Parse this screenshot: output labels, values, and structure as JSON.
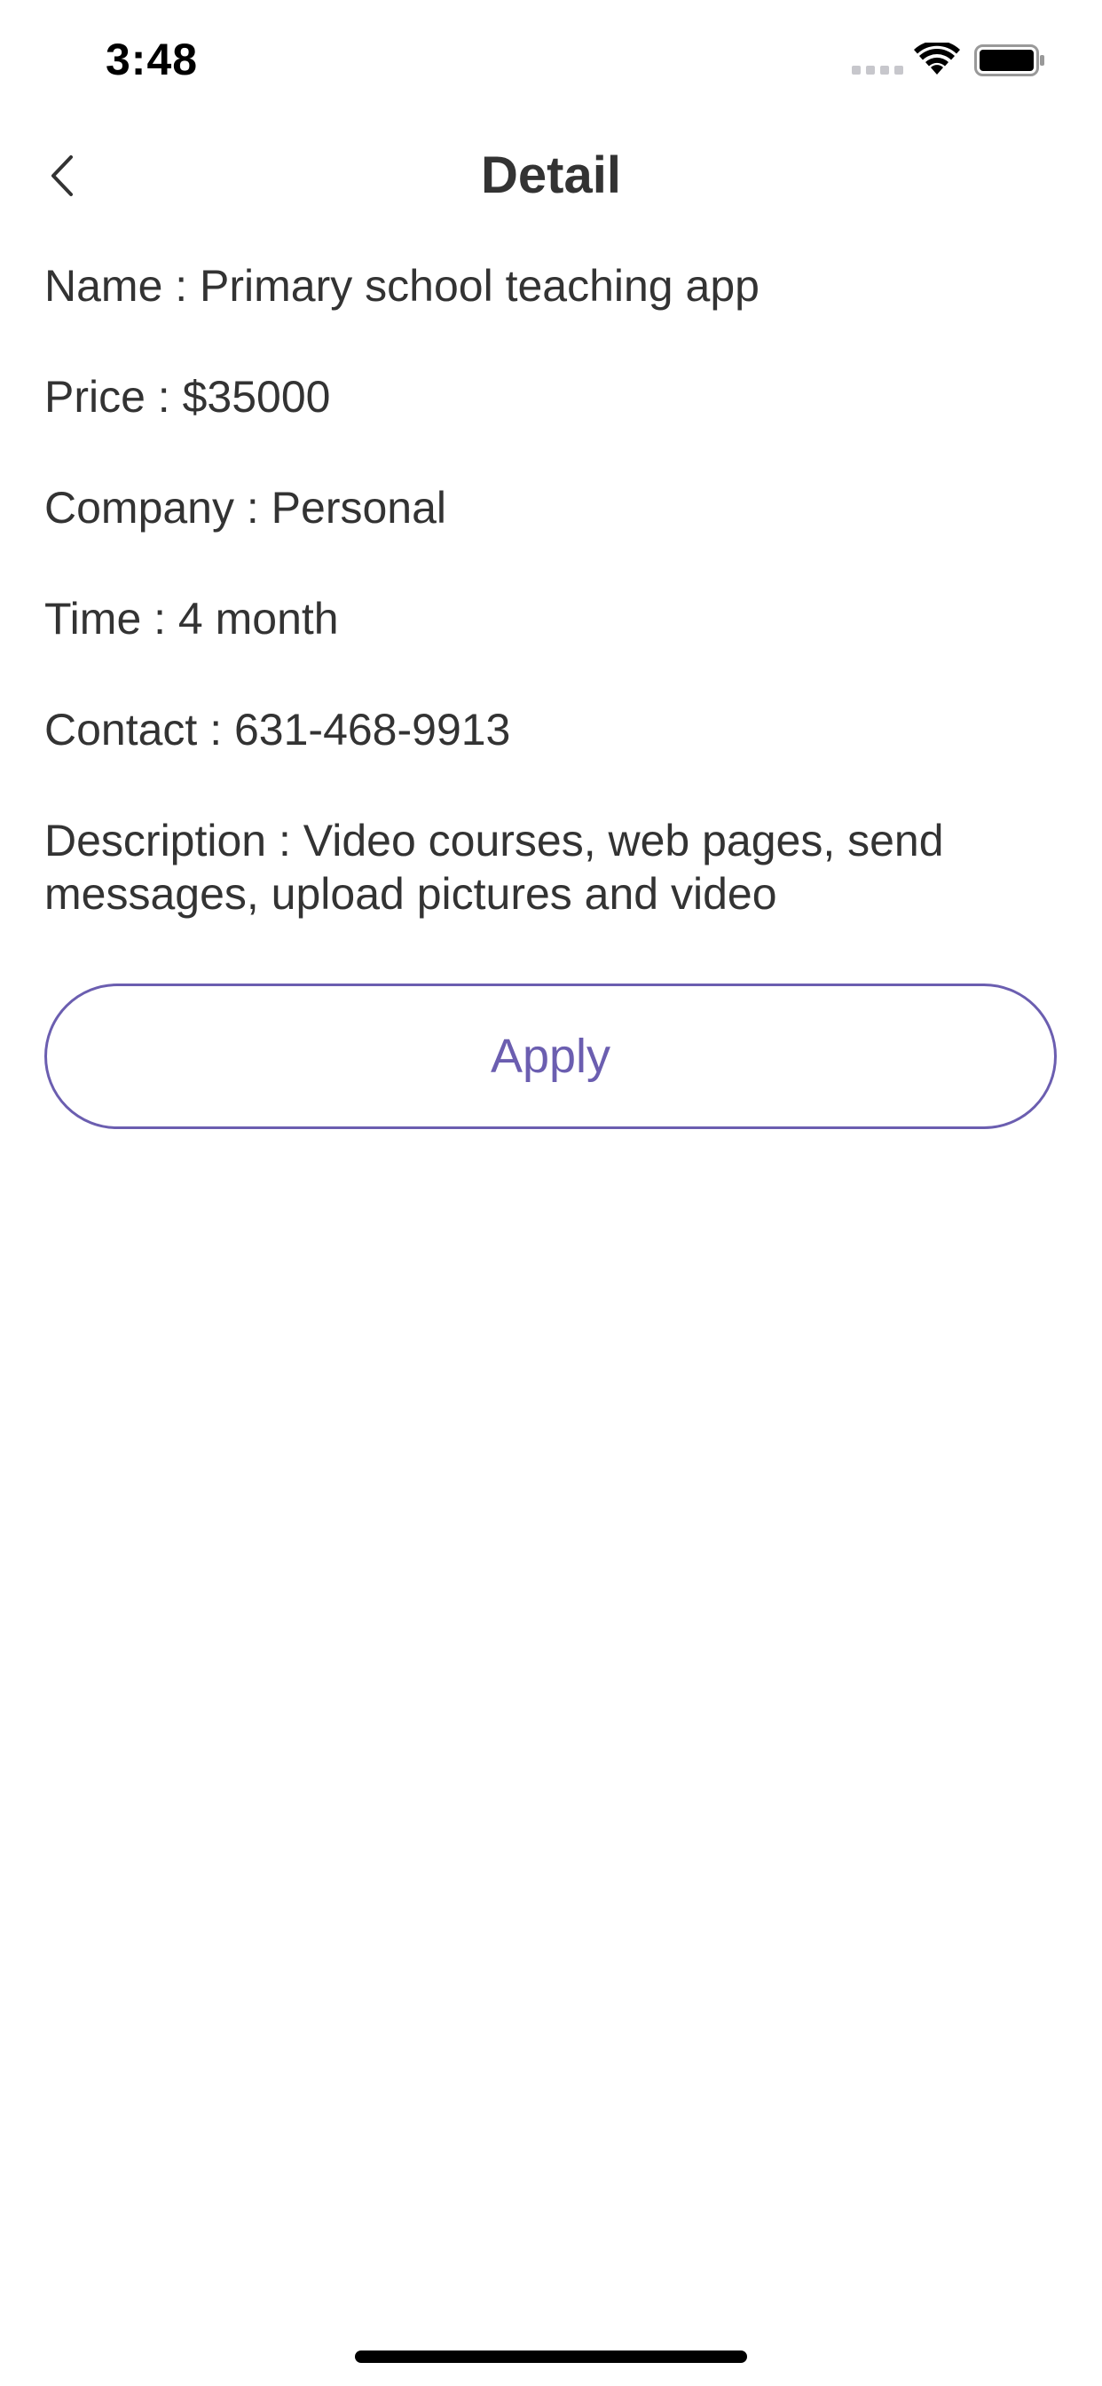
{
  "status_bar": {
    "time": "3:48",
    "icons": [
      "signal-icon",
      "wifi-icon",
      "battery-icon"
    ]
  },
  "nav": {
    "back_icon": "chevron-left-icon",
    "title": "Detail"
  },
  "details": {
    "name": "Name : Primary school teaching app",
    "price": "Price : $35000",
    "company": "Company : Personal",
    "time": "Time : 4 month",
    "contact": "Contact : 631-468-9913",
    "description": "Description : Video courses, web pages, send messages, upload pictures and video"
  },
  "actions": {
    "apply_label": "Apply"
  },
  "colors": {
    "accent": "#6b5eb0",
    "text": "#333333",
    "background": "#ffffff"
  }
}
